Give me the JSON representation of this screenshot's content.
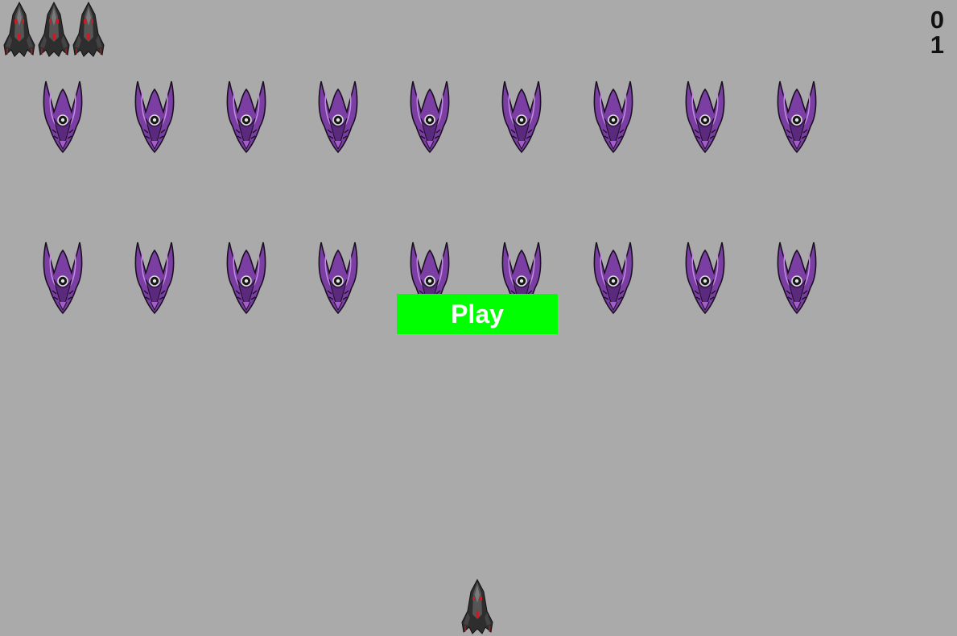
{
  "game": {
    "lives_remaining": 3,
    "score": "0",
    "level": "1",
    "play_label": "Play",
    "alien_formation": {
      "rows": 2,
      "columns": 9
    }
  },
  "colors": {
    "background": "#aaaaaa",
    "play_button": "#00ff00",
    "play_text": "#ffffff",
    "hud_text": "#111111",
    "alien_body": "#7b3fa3",
    "ship_body": "#3a3a3a",
    "ship_accent": "#c0202a"
  },
  "icons": {
    "life": "ship-icon",
    "alien": "alien-ship-icon",
    "player": "player-ship-icon"
  }
}
